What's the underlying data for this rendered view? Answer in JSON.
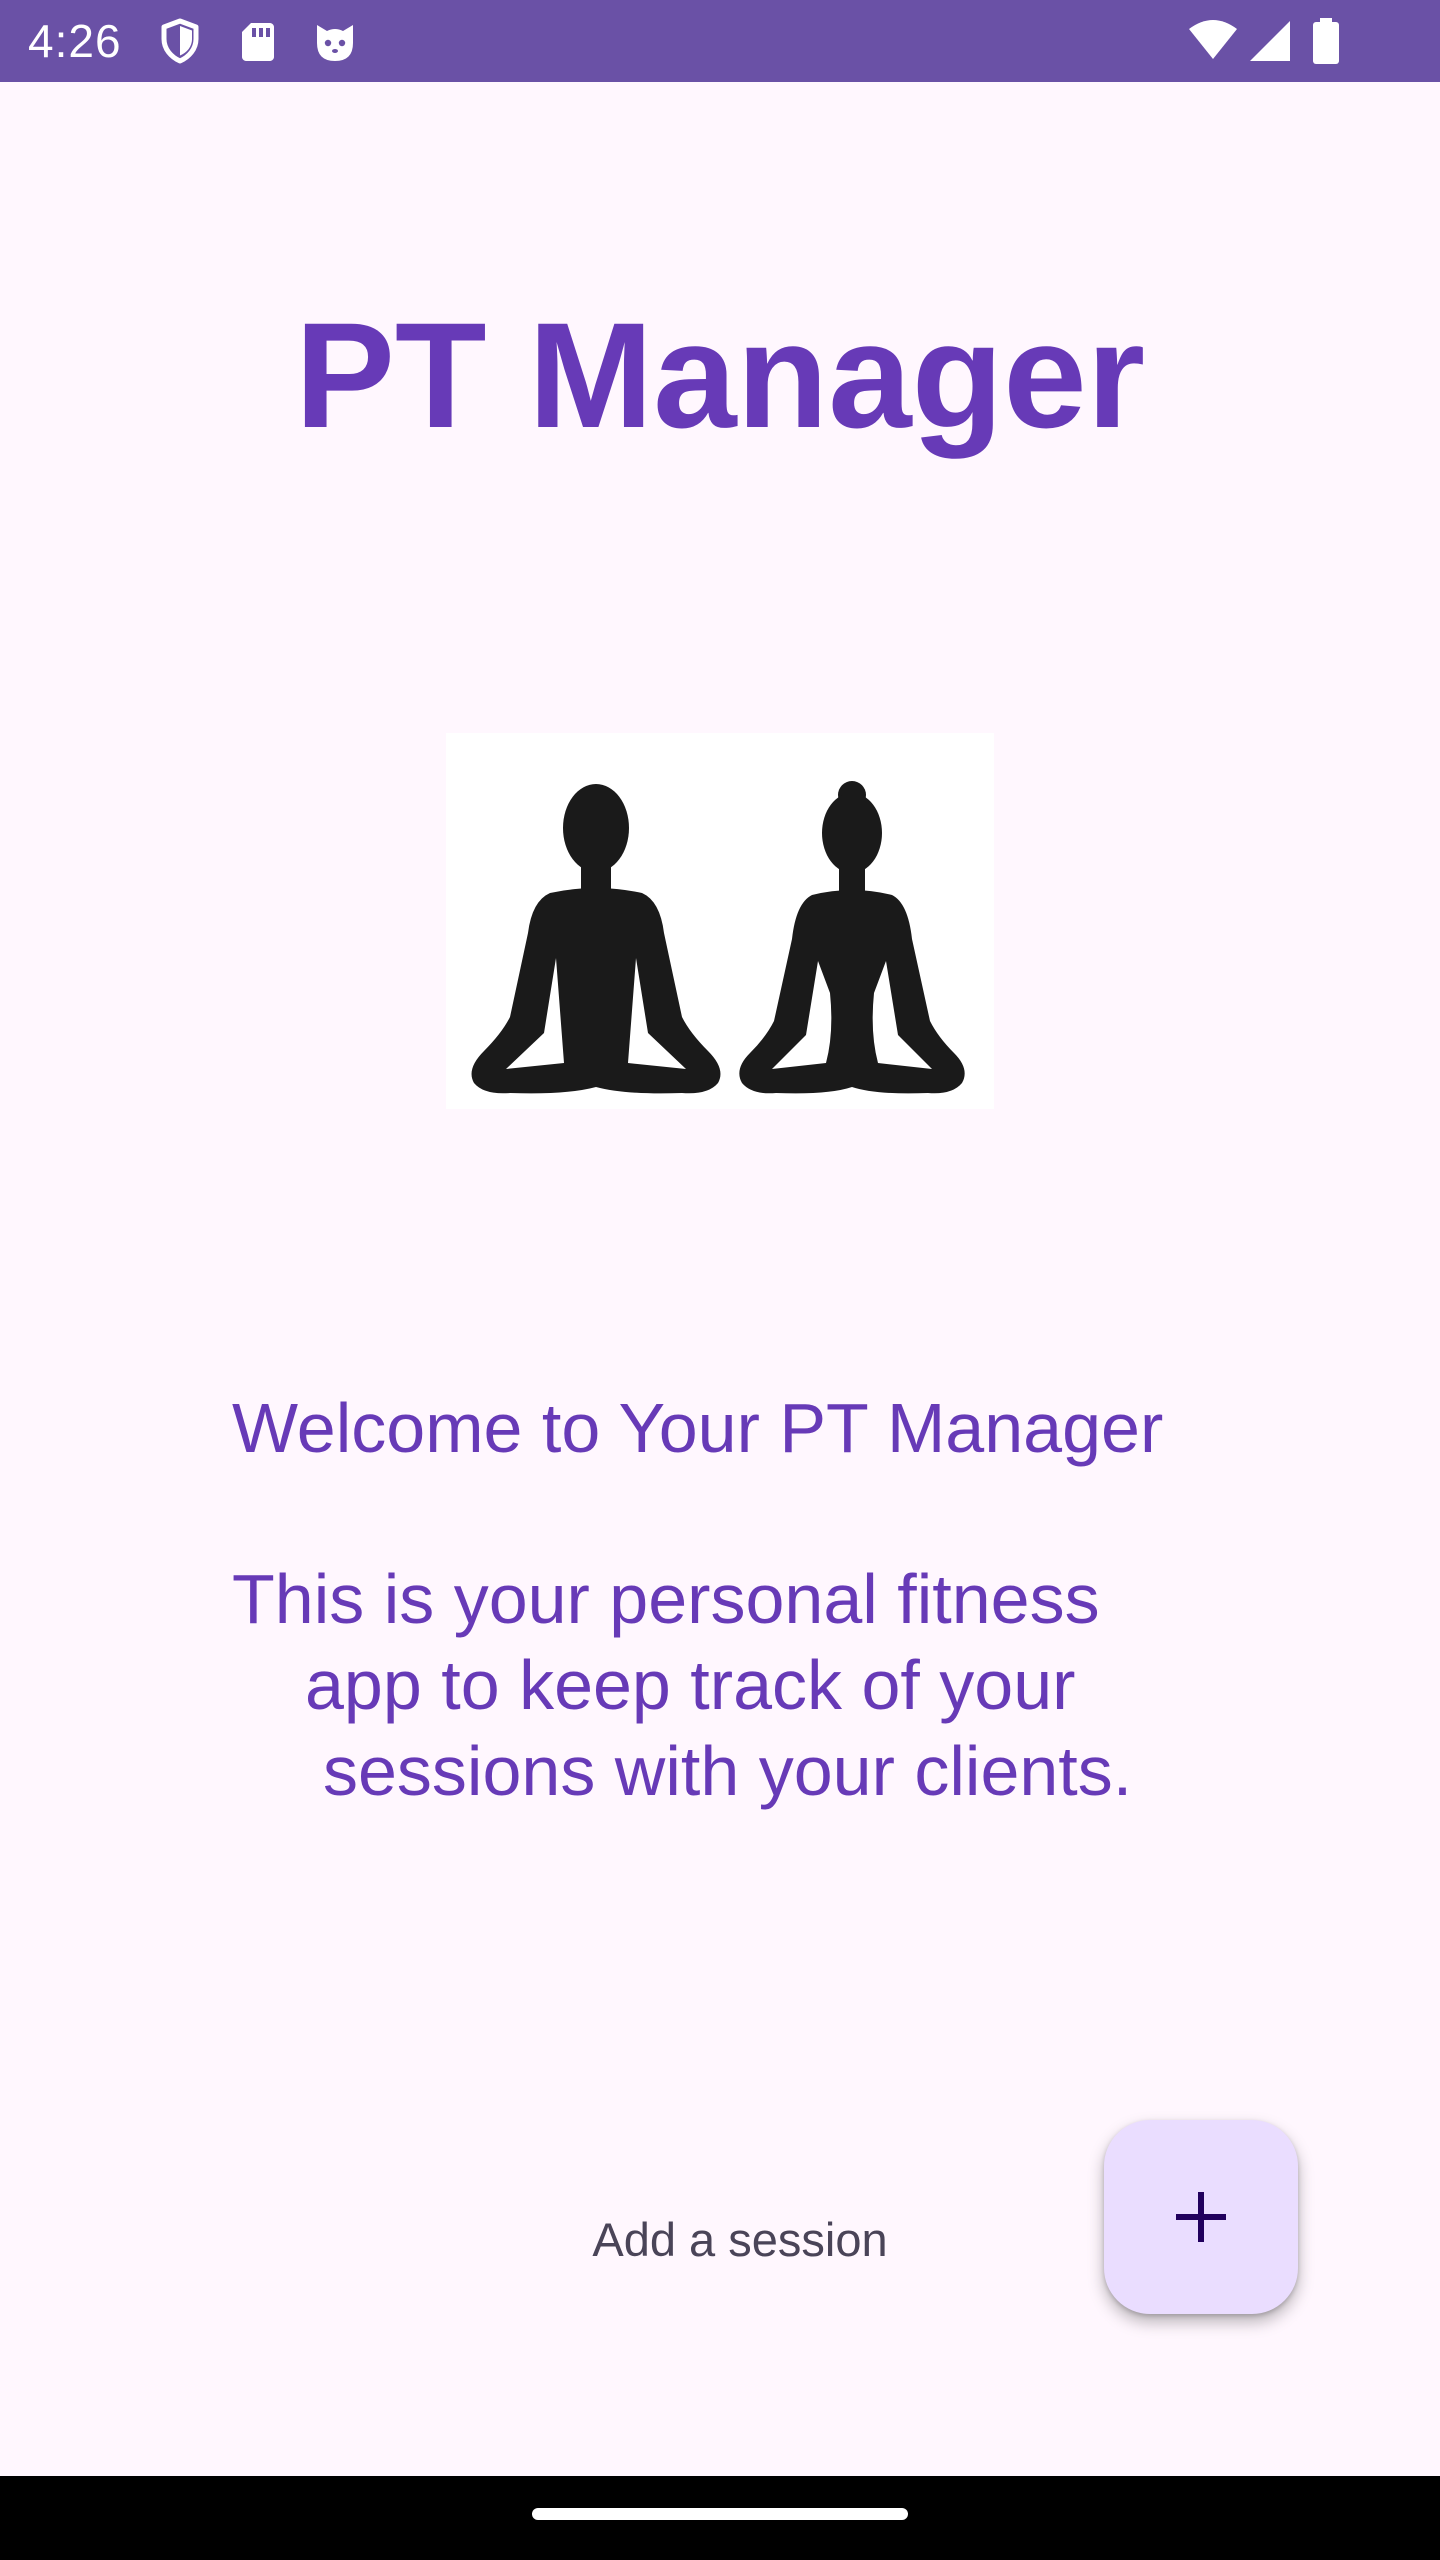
{
  "status_bar": {
    "time": "4:26",
    "background_color": "#6A51A6",
    "left_icons": [
      "shield-icon",
      "sd-card-icon",
      "cat-face-icon"
    ],
    "right_icons": [
      "wifi-icon",
      "cellular-signal-icon",
      "battery-icon"
    ]
  },
  "app": {
    "title": "PT Manager",
    "title_color": "#673AB7"
  },
  "hero": {
    "icon": "meditating-people-icon"
  },
  "welcome": {
    "heading": "Welcome to Your PT Manager",
    "lines": [
      "This is your personal fitness",
      "app to keep track of your",
      "sessions with your clients."
    ]
  },
  "add_session": {
    "label": "Add a session",
    "fab_icon": "plus-icon",
    "fab_color": "#EADDFF"
  },
  "navigation_bar": {
    "handle": "gesture-handle"
  }
}
